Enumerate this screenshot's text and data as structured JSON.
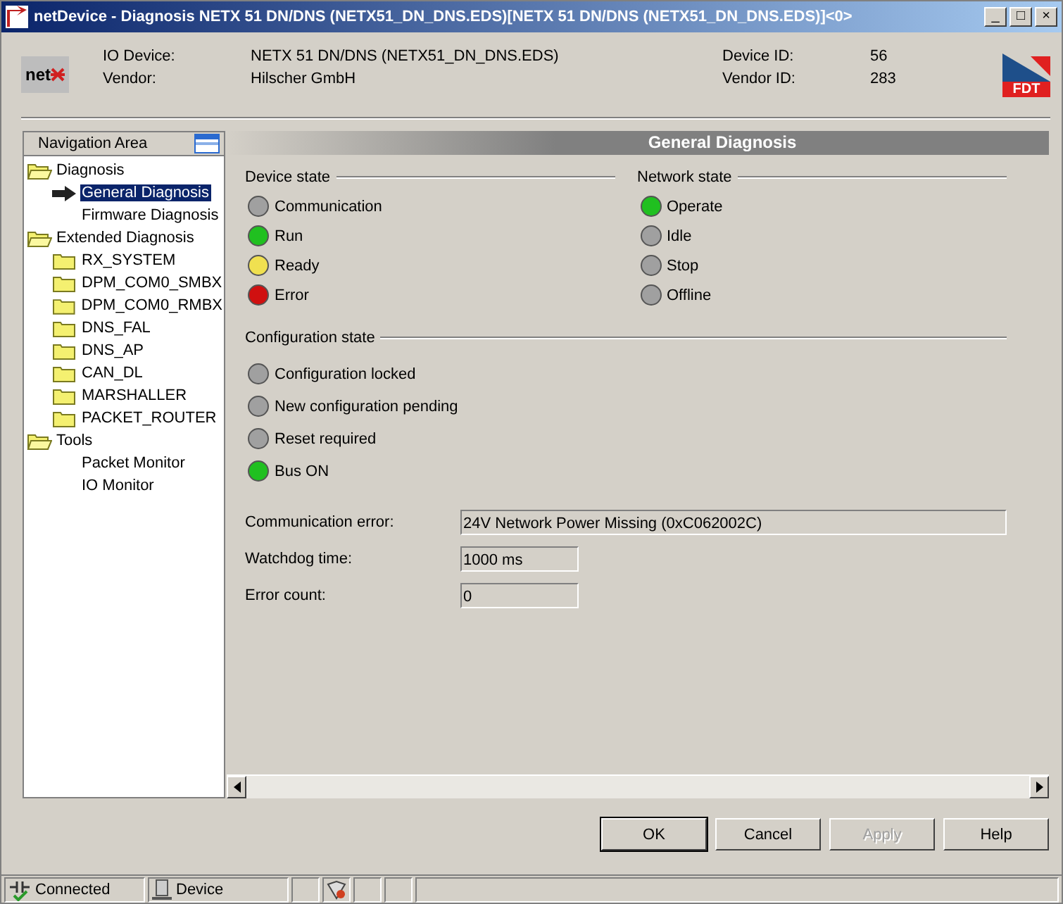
{
  "window": {
    "title": "netDevice - Diagnosis NETX 51 DN/DNS (NETX51_DN_DNS.EDS)[NETX 51 DN/DNS (NETX51_DN_DNS.EDS)]<0>",
    "controls": [
      "_",
      "□",
      "×"
    ]
  },
  "header": {
    "logo": "net",
    "fdt_logo": "FDT",
    "fields": [
      {
        "label": "IO Device:",
        "value": "NETX 51 DN/DNS (NETX51_DN_DNS.EDS)"
      },
      {
        "label": "Vendor:",
        "value": "Hilscher GmbH"
      }
    ],
    "ids": [
      {
        "label": "Device ID:",
        "value": "56"
      },
      {
        "label": "Vendor ID:",
        "value": "283"
      }
    ]
  },
  "navigation": {
    "title": "Navigation Area",
    "items": [
      {
        "label": "Diagnosis",
        "kind": "folder",
        "expanded": true,
        "selected": false,
        "children": [
          {
            "label": "General Diagnosis",
            "kind": "page",
            "selected": true
          },
          {
            "label": "Firmware Diagnosis",
            "kind": "page",
            "selected": false
          }
        ]
      },
      {
        "label": "Extended Diagnosis",
        "kind": "folder",
        "expanded": true,
        "selected": false,
        "children": [
          {
            "label": "RX_SYSTEM",
            "kind": "folder",
            "expanded": false,
            "selected": false
          },
          {
            "label": "DPM_COM0_SMBX",
            "kind": "folder",
            "expanded": false,
            "selected": false
          },
          {
            "label": "DPM_COM0_RMBX",
            "kind": "folder",
            "expanded": false,
            "selected": false
          },
          {
            "label": "DNS_FAL",
            "kind": "folder",
            "expanded": false,
            "selected": false
          },
          {
            "label": "DNS_AP",
            "kind": "folder",
            "expanded": false,
            "selected": false
          },
          {
            "label": "CAN_DL",
            "kind": "folder",
            "expanded": false,
            "selected": false
          },
          {
            "label": "MARSHALLER",
            "kind": "folder",
            "expanded": false,
            "selected": false
          },
          {
            "label": "PACKET_ROUTER",
            "kind": "folder",
            "expanded": false,
            "selected": false
          }
        ]
      },
      {
        "label": "Tools",
        "kind": "folder",
        "expanded": true,
        "selected": false,
        "children": [
          {
            "label": "Packet Monitor",
            "kind": "page",
            "selected": false
          },
          {
            "label": "IO Monitor",
            "kind": "page",
            "selected": false
          }
        ]
      }
    ]
  },
  "panel": {
    "title": "General Diagnosis",
    "device_state": {
      "title": "Device state",
      "leds": [
        {
          "label": "Communication",
          "color": "#a0a0a0"
        },
        {
          "label": "Run",
          "color": "#20c020"
        },
        {
          "label": "Ready",
          "color": "#f0e050"
        },
        {
          "label": "Error",
          "color": "#d01010"
        }
      ]
    },
    "network_state": {
      "title": "Network state",
      "leds": [
        {
          "label": "Operate",
          "color": "#20c020"
        },
        {
          "label": "Idle",
          "color": "#a0a0a0"
        },
        {
          "label": "Stop",
          "color": "#a0a0a0"
        },
        {
          "label": "Offline",
          "color": "#a0a0a0"
        }
      ]
    },
    "configuration_state": {
      "title": "Configuration state",
      "leds": [
        {
          "label": "Configuration locked",
          "color": "#a0a0a0"
        },
        {
          "label": "New configuration pending",
          "color": "#a0a0a0"
        },
        {
          "label": "Reset required",
          "color": "#a0a0a0"
        },
        {
          "label": "Bus ON",
          "color": "#20c020"
        }
      ]
    },
    "fields": [
      {
        "label": "Communication error:",
        "value": "24V Network Power Missing (0xC062002C)",
        "kind": "wide"
      },
      {
        "label": "Watchdog time:",
        "value": "1000  ms",
        "kind": "short"
      },
      {
        "label": "Error count:",
        "value": "0",
        "kind": "short"
      }
    ]
  },
  "buttons": [
    {
      "label": "OK",
      "disabled": false,
      "default": true
    },
    {
      "label": "Cancel",
      "disabled": false,
      "default": false
    },
    {
      "label": "Apply",
      "disabled": true,
      "default": false
    },
    {
      "label": "Help",
      "disabled": false,
      "default": false
    }
  ],
  "status_bar": [
    {
      "label": "Connected",
      "kind": "connected"
    },
    {
      "label": "Device",
      "kind": "device"
    },
    {
      "kind": "empty"
    },
    {
      "kind": "shield"
    },
    {
      "kind": "empty"
    },
    {
      "kind": "empty"
    },
    {
      "kind": "fill"
    }
  ]
}
